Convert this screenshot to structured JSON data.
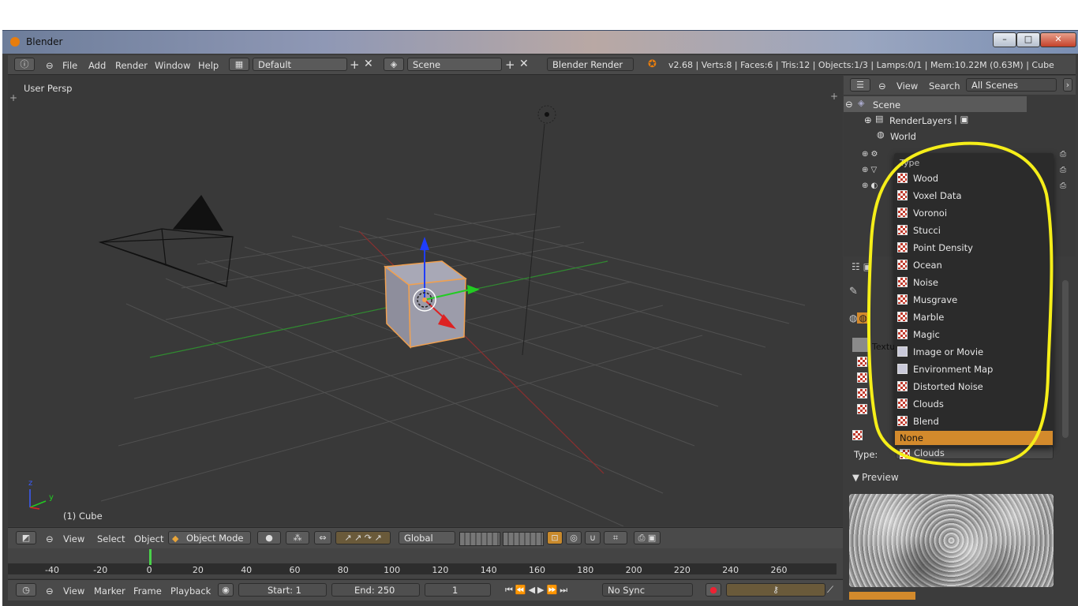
{
  "window": {
    "title": "Blender",
    "minimize": "–",
    "maximize": "□",
    "close": "✕"
  },
  "topbar": {
    "menus": [
      "File",
      "Add",
      "Render",
      "Window",
      "Help"
    ],
    "layout": "Default",
    "scene": "Scene",
    "engine": "Blender Render",
    "stats": "v2.68 | Verts:8 | Faces:6 | Tris:12 | Objects:1/3 | Lamps:0/1 | Mem:10.22M (0.63M) | Cube"
  },
  "viewport": {
    "label": "User Persp",
    "object": "(1) Cube",
    "axis_z": "z",
    "axis_y": "y"
  },
  "view3d_header": {
    "menus": [
      "View",
      "Select",
      "Object"
    ],
    "mode": "Object Mode",
    "orientation": "Global"
  },
  "timeline": {
    "ticks": [
      "-40",
      "-20",
      "0",
      "20",
      "40",
      "60",
      "80",
      "100",
      "120",
      "140",
      "160",
      "180",
      "200",
      "220",
      "240",
      "260"
    ],
    "current_frame": 0,
    "menus": [
      "View",
      "Marker",
      "Frame",
      "Playback"
    ],
    "start": "Start: 1",
    "end": "End: 250",
    "frame": "1",
    "sync": "No Sync"
  },
  "outliner": {
    "menus": [
      "View",
      "Search"
    ],
    "filter": "All Scenes",
    "scene": "Scene",
    "render_layers": "RenderLayers",
    "world": "World"
  },
  "dropdown": {
    "title": "Type",
    "items": [
      "Wood",
      "Voxel Data",
      "Voronoi",
      "Stucci",
      "Point Density",
      "Ocean",
      "Noise",
      "Musgrave",
      "Marble",
      "Magic",
      "Image or Movie",
      "Environment Map",
      "Distorted Noise",
      "Clouds",
      "Blend"
    ],
    "selected": "None"
  },
  "properties": {
    "type_label": "Type:",
    "type_value": "Clouds",
    "preview_label": "Preview",
    "tab_partial": "Textu"
  },
  "colors": {
    "annotation": "#f5ee19",
    "accent_orange": "#d38a2c",
    "viewport_bg": "#393939"
  }
}
